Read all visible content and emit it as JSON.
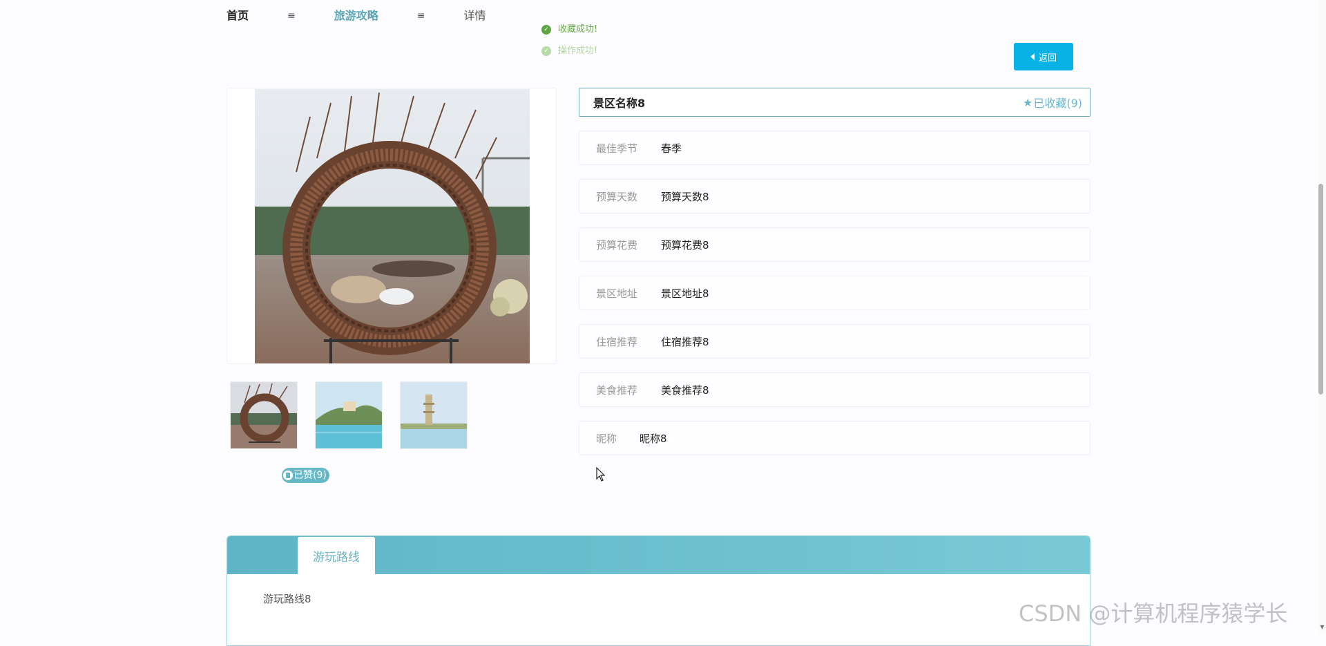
{
  "breadcrumb": {
    "home": "首页",
    "separator1": "≡",
    "section": "旅游攻略",
    "separator2": "≡",
    "current": "详情"
  },
  "toasts": [
    {
      "text": "收藏成功!",
      "status": "success",
      "color": "#5ea544"
    },
    {
      "text": "操作成功!",
      "status": "success-fading",
      "color": "#b6dba7"
    }
  ],
  "back_button": {
    "label": "返回",
    "icon": "caret-left-icon",
    "color": "#08b2e6"
  },
  "gallery": {
    "main_image": "ring-sculpture-photo",
    "thumbnails": [
      "ring-sculpture-thumb",
      "lakeside-temple-thumb",
      "lake-pagoda-thumb"
    ]
  },
  "like": {
    "label": "已赞(9)",
    "icon": "thumbs-up-icon"
  },
  "detail": {
    "title": "景区名称8",
    "favorite_label": "已收藏(9)",
    "favorite_icon": "star-icon",
    "fields": [
      {
        "label": "最佳季节",
        "value": "春季"
      },
      {
        "label": "预算天数",
        "value": "预算天数8"
      },
      {
        "label": "预算花费",
        "value": "预算花费8"
      },
      {
        "label": "景区地址",
        "value": "景区地址8"
      },
      {
        "label": "住宿推荐",
        "value": "住宿推荐8"
      },
      {
        "label": "美食推荐",
        "value": "美食推荐8"
      },
      {
        "label": "昵称",
        "value": "昵称8"
      }
    ]
  },
  "tabs": {
    "items": [
      {
        "label": "游玩路线",
        "active": true
      }
    ],
    "content": "游玩路线8"
  },
  "watermark": "CSDN @计算机程序猿学长",
  "colors": {
    "accent": "#66b8c7",
    "tab_bar": "#5fb5c5",
    "button": "#08b2e6"
  }
}
